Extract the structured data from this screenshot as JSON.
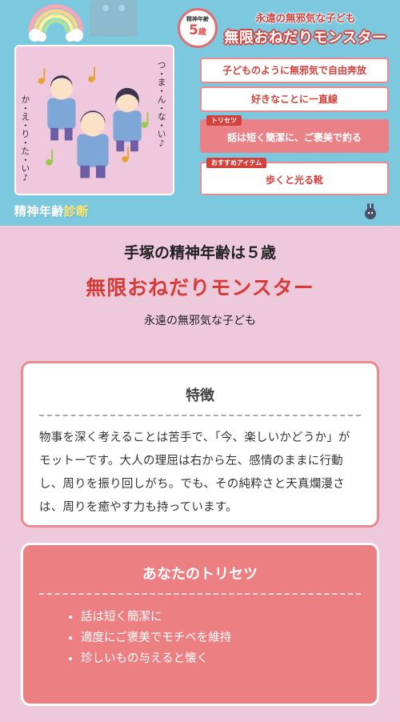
{
  "card": {
    "badge_top": "精神年齢",
    "badge_age": "5",
    "badge_unit": "歳",
    "subtitle": "永遠の無邪気な子ども",
    "title": "無限おねだりモンスター",
    "traits": [
      "子どものように無邪気で自由奔放",
      "好きなことに一直線"
    ],
    "torisetsu_tag": "トリセツ",
    "torisetsu": "話は短く簡潔に、ご褒美で釣る",
    "item_tag": "おすすめアイテム",
    "item": "歩くと光る靴",
    "logo_main": "精神年齢",
    "logo_accent": "診断",
    "illus_text_1": "つ・ま・ん・な・い♪",
    "illus_text_2": "か・え・り・た・い♪"
  },
  "result": {
    "line": "手塚の精神年齢は５歳",
    "title": "無限おねだりモンスター",
    "subtitle": "永遠の無邪気な子ども"
  },
  "features": {
    "heading": "特徴",
    "text": "物事を深く考えることは苦手で、「今、楽しいかどうか」がモットーです。大人の理屈は右から左、感情のままに行動し、周りを振り回しがち。でも、その純粋さと天真爛漫さは、周りを癒やす力も持っています。"
  },
  "torisetsu": {
    "heading": "あなたのトリセツ",
    "items": [
      "話は短く簡潔に",
      "適度にご褒美でモチベを維持",
      "珍しいもの与えると懐く"
    ]
  },
  "colors": {
    "accent": "#d63b35",
    "header_bg": "#7cc8df",
    "page_bg": "#eec9dc",
    "pink_box": "#ec7f82"
  }
}
